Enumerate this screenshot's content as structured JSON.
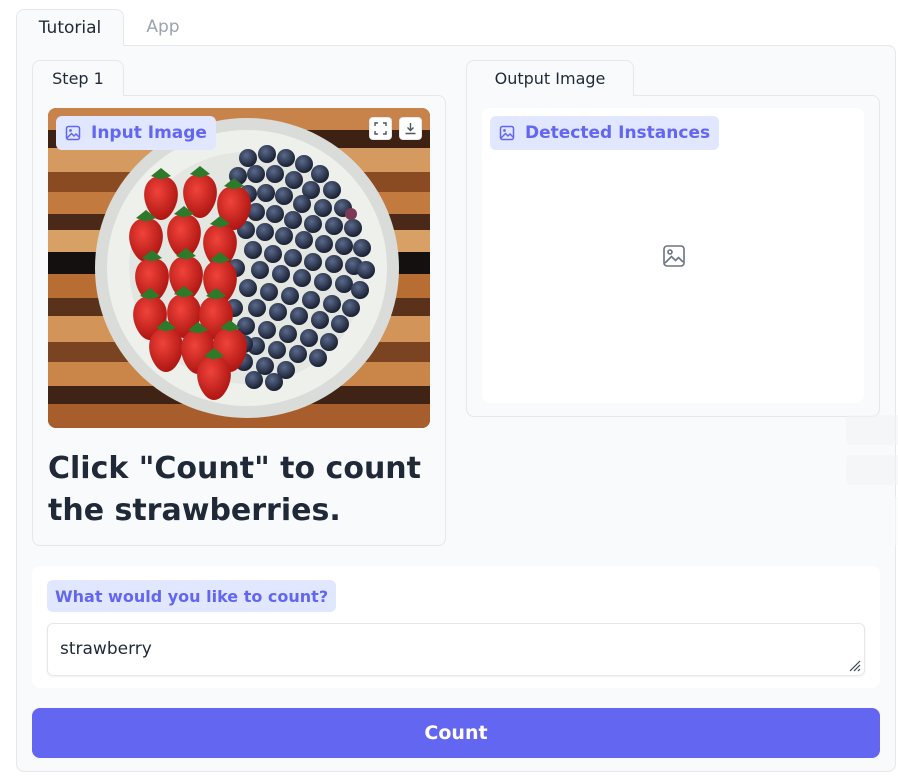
{
  "tabs": [
    {
      "label": "Tutorial",
      "active": true
    },
    {
      "label": "App",
      "active": false
    }
  ],
  "step": {
    "tab_label": "Step 1",
    "image_label": "Input Image",
    "image_icon": "image-icon",
    "instruction": "Click \"Count\" to count the strawberries."
  },
  "output": {
    "tab_label": "Output Image",
    "image_label": "Detected Instances",
    "placeholder_icon": "image-placeholder-icon"
  },
  "count_input": {
    "label": "What would you like to count?",
    "value": "strawberry"
  },
  "count_button": {
    "label": "Count"
  },
  "colors": {
    "accent": "#6366f1",
    "chip_bg": "#e0e7ff",
    "panel_bg": "#f9fafb",
    "border": "#e5e7eb"
  }
}
